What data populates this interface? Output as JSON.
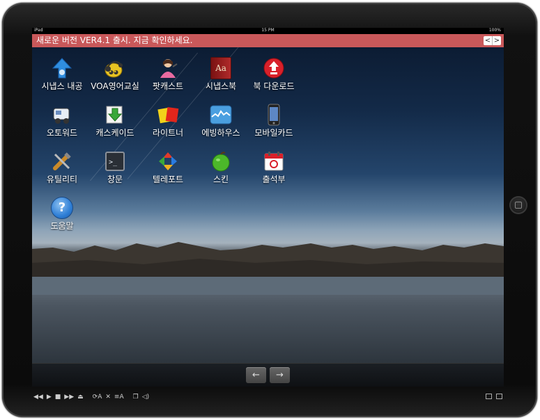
{
  "status_bar": {
    "device": "iPad",
    "time": "15 PM",
    "battery": "100%"
  },
  "notice": {
    "text": "새로운 버전 VER4.1 출시. 지금 확인하세요.",
    "prev_glyph": "<",
    "next_glyph": ">"
  },
  "apps": [
    {
      "label": "시냅스 내공",
      "icon": "upload-arrow-icon"
    },
    {
      "label": "VOA영어교실",
      "icon": "headset-icon"
    },
    {
      "label": "팟캐스트",
      "icon": "podcast-person-icon"
    },
    {
      "label": "시냅스북",
      "icon": "book-icon",
      "glyph": "Aa"
    },
    {
      "label": "북 다운로드",
      "icon": "download-icon"
    },
    {
      "label": "오토워드",
      "icon": "auto-word-icon"
    },
    {
      "label": "캐스케이드",
      "icon": "cascade-arrow-icon"
    },
    {
      "label": "라이트너",
      "icon": "cards-icon"
    },
    {
      "label": "에빙하우스",
      "icon": "chart-icon"
    },
    {
      "label": "모바일카드",
      "icon": "phone-icon"
    },
    {
      "label": "유틸리티",
      "icon": "tools-icon"
    },
    {
      "label": "창문",
      "icon": "terminal-icon",
      "glyph": ">_"
    },
    {
      "label": "텔레포트",
      "icon": "teleport-icon"
    },
    {
      "label": "스킨",
      "icon": "apple-icon"
    },
    {
      "label": "출석부",
      "icon": "calendar-icon"
    },
    {
      "label": "도움말",
      "icon": "help-icon",
      "glyph": "?"
    }
  ],
  "dock": {
    "prev_glyph": "←",
    "next_glyph": "→"
  },
  "player": {
    "labels": [
      "A",
      "A"
    ]
  },
  "colors": {
    "notice_bg": "#c9585a",
    "accent": "#2f7fd6"
  }
}
